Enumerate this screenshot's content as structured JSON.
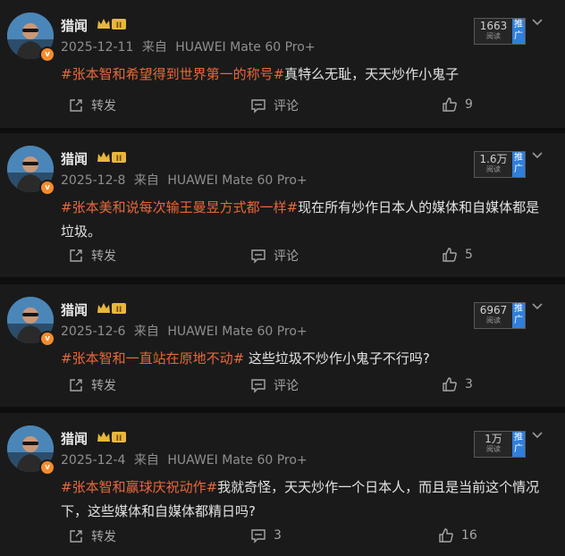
{
  "posts": [
    {
      "author": "猎闻",
      "date": "2025-12-11",
      "source_prefix": "来自",
      "device": "HUAWEI Mate 60 Pro+",
      "topic": "#张本智和希望得到世界第一的称号#",
      "text": "真特么无耻，天天炒作小鬼子",
      "reads": "1663",
      "reads_label": "阅读",
      "promote_label": "推广",
      "repost_label": "转发",
      "comment_label": "评论",
      "likes": "9"
    },
    {
      "author": "猎闻",
      "date": "2025-12-8",
      "source_prefix": "来自",
      "device": "HUAWEI Mate 60 Pro+",
      "topic": "#张本美和说每次输王曼昱方式都一样#",
      "text": "现在所有炒作日本人的媒体和自媒体都是垃圾。",
      "reads": "1.6万",
      "reads_label": "阅读",
      "promote_label": "推广",
      "repost_label": "转发",
      "comment_label": "评论",
      "likes": "5"
    },
    {
      "author": "猎闻",
      "date": "2025-12-6",
      "source_prefix": "来自",
      "device": "HUAWEI Mate 60 Pro+",
      "topic": "#张本智和一直站在原地不动#",
      "text": " 这些垃圾不炒作小鬼子不行吗?",
      "reads": "6967",
      "reads_label": "阅读",
      "promote_label": "推广",
      "repost_label": "转发",
      "comment_label": "评论",
      "likes": "3"
    },
    {
      "author": "猎闻",
      "date": "2025-12-4",
      "source_prefix": "来自",
      "device": "HUAWEI Mate 60 Pro+",
      "topic": "#张本智和赢球庆祝动作#",
      "text": "我就奇怪，天天炒作一个日本人，而且是当前这个情况下，这些媒体和自媒体都精日吗?",
      "reads": "1万",
      "reads_label": "阅读",
      "promote_label": "推广",
      "repost_label": "转发",
      "comment_label": "3",
      "likes": "16"
    }
  ],
  "badge": {
    "verified_mark": "v",
    "rank_mark": "II"
  },
  "colors": {
    "topic": "#e8683a",
    "promote": "#2f7fdb",
    "verified": "#f78b2a",
    "background": "#1a1a1a"
  },
  "icons": [
    "chevron-down-icon",
    "repost-icon",
    "comment-icon",
    "like-icon",
    "verified-icon",
    "rank-crown-icon"
  ]
}
